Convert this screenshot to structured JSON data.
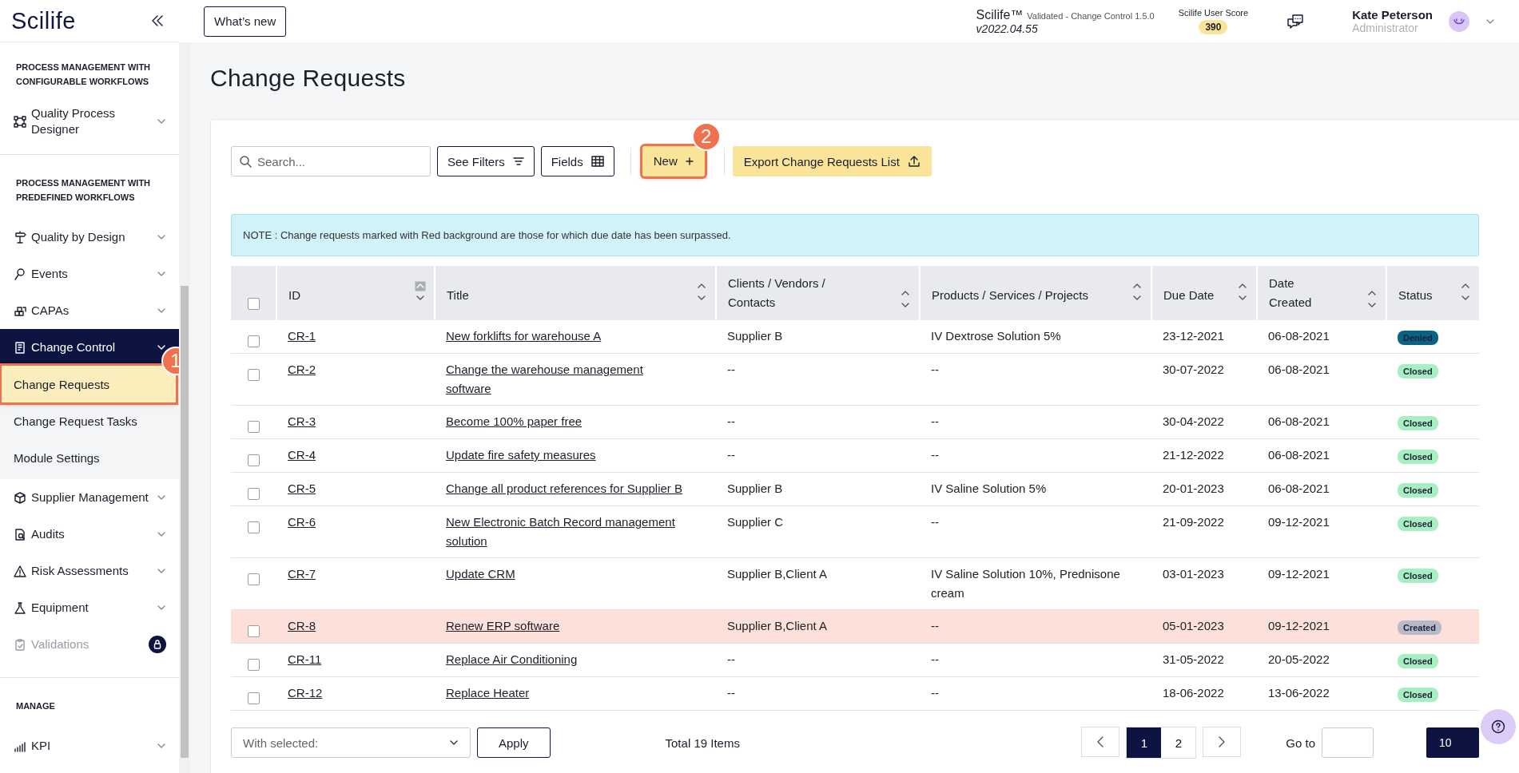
{
  "sidebar": {
    "logo": "Scilife",
    "sections": [
      {
        "heading": "PROCESS MANAGEMENT WITH CONFIGURABLE WORKFLOWS",
        "items": [
          {
            "label": "Quality Process Designer",
            "selected": false,
            "disabled": false
          }
        ]
      },
      {
        "heading": "PROCESS MANAGEMENT WITH PREDEFINED WORKFLOWS",
        "items": [
          {
            "label": "Quality by Design",
            "selected": false,
            "disabled": false
          },
          {
            "label": "Events",
            "selected": false,
            "disabled": false
          },
          {
            "label": "CAPAs",
            "selected": false,
            "disabled": false
          },
          {
            "label": "Change Control",
            "selected": true,
            "disabled": false,
            "children": [
              {
                "label": "Change Requests",
                "selected": true,
                "step": "1"
              },
              {
                "label": "Change Request Tasks",
                "selected": false
              },
              {
                "label": "Module Settings",
                "selected": false
              }
            ]
          },
          {
            "label": "Supplier Management",
            "selected": false,
            "disabled": false
          },
          {
            "label": "Audits",
            "selected": false,
            "disabled": false
          },
          {
            "label": "Risk Assessments",
            "selected": false,
            "disabled": false
          },
          {
            "label": "Equipment",
            "selected": false,
            "disabled": false
          },
          {
            "label": "Validations",
            "selected": false,
            "disabled": true,
            "locked": true
          }
        ]
      },
      {
        "heading": "MANAGE",
        "items": [
          {
            "label": "KPI",
            "selected": false,
            "disabled": false
          }
        ]
      }
    ]
  },
  "header": {
    "whats_new": "What’s new",
    "product": "Scilife™",
    "edition": "Validated - Change Control 1.5.0",
    "version": "v2022.04.55",
    "score_label": "Scilife User Score",
    "score": "390",
    "user_name": "Kate Peterson",
    "user_role": "Administrator"
  },
  "page_title": "Change Requests",
  "toolbar": {
    "search_placeholder": "Search...",
    "filters": "See Filters",
    "fields": "Fields",
    "new": {
      "label": "New",
      "step": "2",
      "highlighted": true
    },
    "export": "Export Change Requests List"
  },
  "note": "NOTE : Change requests marked with Red background are those for which due date has been surpassed.",
  "table": {
    "select_all_checked": false,
    "columns": [
      {
        "label": "ID",
        "sorted": true
      },
      {
        "label": "Title",
        "sorted": false
      },
      {
        "label": "Clients / Vendors / Contacts",
        "sorted": false
      },
      {
        "label": "Products / Services / Projects",
        "sorted": false
      },
      {
        "label": "Due Date",
        "sorted": false
      },
      {
        "label": "Date Created",
        "sorted": false
      },
      {
        "label": "Status",
        "sorted": false
      }
    ],
    "rows": [
      {
        "checked": false,
        "overdue": false,
        "id": "CR-1",
        "title": "New forklifts for warehouse A",
        "clients": "Supplier B",
        "products": "IV Dextrose Solution 5%",
        "due": "23-12-2021",
        "created": "06-08-2021",
        "status": "Denied",
        "color": "#0b6384"
      },
      {
        "checked": false,
        "overdue": false,
        "id": "CR-2",
        "title": "Change the warehouse management software",
        "clients": "--",
        "products": "--",
        "due": "30-07-2022",
        "created": "06-08-2021",
        "status": "Closed",
        "color": "#a7eec3"
      },
      {
        "checked": false,
        "overdue": false,
        "id": "CR-3",
        "title": "Become 100% paper free",
        "clients": "--",
        "products": "--",
        "due": "30-04-2022",
        "created": "06-08-2021",
        "status": "Closed",
        "color": "#a7eec3"
      },
      {
        "checked": false,
        "overdue": false,
        "id": "CR-4",
        "title": "Update fire safety measures",
        "clients": "--",
        "products": "--",
        "due": "21-12-2022",
        "created": "06-08-2021",
        "status": "Closed",
        "color": "#a7eec3"
      },
      {
        "checked": false,
        "overdue": false,
        "id": "CR-5",
        "title": "Change all product references for Supplier B",
        "clients": "Supplier B",
        "products": "IV Saline Solution 5%",
        "due": "20-01-2023",
        "created": "06-08-2021",
        "status": "Closed",
        "color": "#a7eec3"
      },
      {
        "checked": false,
        "overdue": false,
        "id": "CR-6",
        "title": "New Electronic Batch Record management solution",
        "clients": "Supplier C",
        "products": "--",
        "due": "21-09-2022",
        "created": "09-12-2021",
        "status": "Closed",
        "color": "#a7eec3"
      },
      {
        "checked": false,
        "overdue": false,
        "id": "CR-7",
        "title": "Update CRM",
        "clients": "Supplier B,Client A",
        "products": "IV Saline Solution 10%, Prednisone cream",
        "due": "03-01-2023",
        "created": "09-12-2021",
        "status": "Closed",
        "color": "#a7eec3"
      },
      {
        "checked": false,
        "overdue": true,
        "id": "CR-8",
        "title": "Renew ERP software",
        "clients": "Supplier B,Client A",
        "products": "--",
        "due": "05-01-2023",
        "created": "09-12-2021",
        "status": "Created",
        "color": "#b7bac9"
      },
      {
        "checked": false,
        "overdue": false,
        "id": "CR-11",
        "title": "Replace Air Conditioning",
        "clients": "--",
        "products": "--",
        "due": "31-05-2022",
        "created": "20-05-2022",
        "status": "Closed",
        "color": "#a7eec3"
      },
      {
        "checked": false,
        "overdue": false,
        "id": "CR-12",
        "title": "Replace Heater",
        "clients": "--",
        "products": "--",
        "due": "18-06-2022",
        "created": "13-06-2022",
        "status": "Closed",
        "color": "#a7eec3"
      }
    ]
  },
  "footer": {
    "bulk_placeholder": "With selected:",
    "apply": "Apply",
    "total": "Total 19 Items",
    "pages": [
      {
        "label": "1",
        "selected": true
      },
      {
        "label": "2",
        "selected": false
      }
    ],
    "goto": "Go to",
    "page_size": "10"
  }
}
